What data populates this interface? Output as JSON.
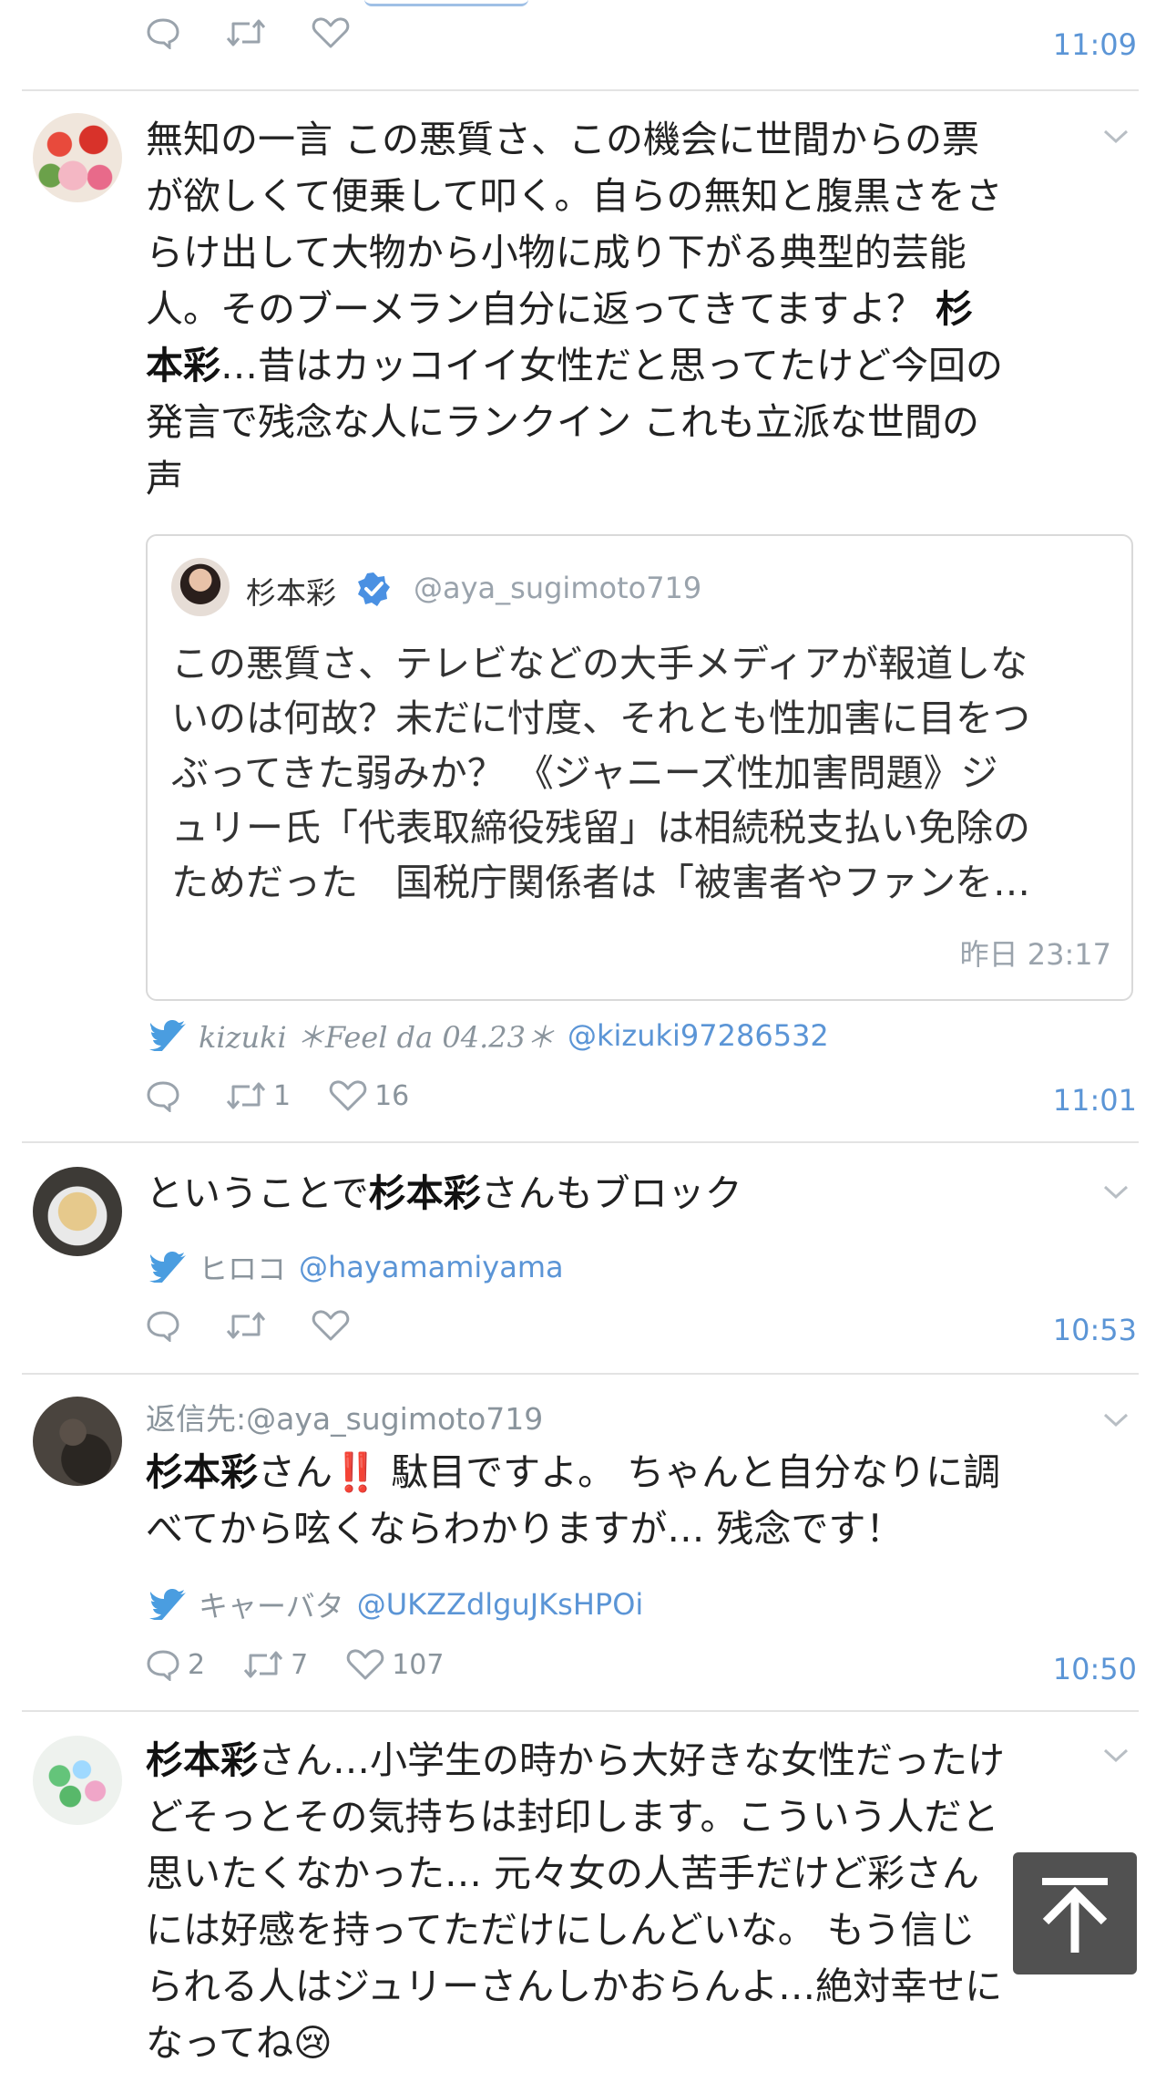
{
  "tweets": [
    {
      "actions": {
        "reply_count": "",
        "retweet_count": "",
        "like_count": ""
      },
      "time": "11:09"
    },
    {
      "body_lines": [
        "無知の一言 この悪質さ、この機会に世間からの票",
        "が欲しくて便乗して叩く。自らの無知と腹黒さをさ",
        "らけ出して大物から小物に成り下がる典型的芸能",
        "人。そのブーメラン自分に返ってきてますよ？ ",
        "…昔はカッコイイ女性だと思ってたけど今回の",
        "発言で残念な人にランクイン これも立派な世間の",
        "声"
      ],
      "body_bold_a": "杉",
      "body_bold_b": "本彩",
      "quote": {
        "author_name": "杉本彩",
        "author_handle": "@aya_sugimoto719",
        "text_lines": [
          "この悪質さ、テレビなどの大手メディアが報道しな",
          "いのは何故？未だに忖度、それとも性加害に目をつ",
          "ぶってきた弱みか？ 《ジャニーズ性加害問題》ジ",
          "ュリー氏「代表取締役残留」は相続税支払い免除の",
          "ためだった　国税庁関係者は「被害者やファンを…"
        ],
        "timestamp": "昨日 23:17"
      },
      "source": {
        "name": "kizuki ＊Feel da 04.23＊",
        "handle": "@kizuki97286532"
      },
      "actions": {
        "reply_count": "",
        "retweet_count": "1",
        "like_count": "16"
      },
      "time": "11:01"
    },
    {
      "body_pre": "ということで",
      "body_bold": "杉本彩",
      "body_post": "さんもブロック",
      "source": {
        "name": "ヒロコ",
        "handle": "@hayamamiyama"
      },
      "actions": {
        "reply_count": "",
        "retweet_count": "",
        "like_count": ""
      },
      "time": "10:53"
    },
    {
      "reply_to": "返信先:@aya_sugimoto719",
      "body_bold": "杉本彩",
      "body_line1_post": "さん",
      "body_line1_emoji": "‼️",
      "body_line1_rest": " 駄目ですよ。 ちゃんと自分なりに調",
      "body_line2": "べてから呟くならわかりますが… 残念です！",
      "source": {
        "name": "キャーバタ",
        "handle": "@UKZZdlguJKsHPOi"
      },
      "actions": {
        "reply_count": "2",
        "retweet_count": "7",
        "like_count": "107"
      },
      "time": "10:50"
    },
    {
      "body_bold": "杉本彩",
      "body_line1_post": "さん…小学生の時から大好きな女性だったけ",
      "body_lines": [
        "どそっとその気持ちは封印します。こういう人だと",
        "思いたくなかった… 元々女の人苦手だけど彩さん",
        "には好感を持ってただけにしんどいな。 もう信じ",
        "られる人はジュリーさんしかおらんよ…絶対幸せに",
        "なってね"
      ],
      "body_emoji": "😢"
    }
  ],
  "colors": {
    "link": "#5b95d6",
    "icon": "#9aa3ac",
    "verified": "#4a90e2",
    "twitter": "#4a9de0"
  },
  "icons": [
    "reply-icon",
    "retweet-icon",
    "like-icon",
    "chevron-down-icon",
    "twitter-bird-icon",
    "verified-badge-icon",
    "scroll-to-top-icon"
  ]
}
